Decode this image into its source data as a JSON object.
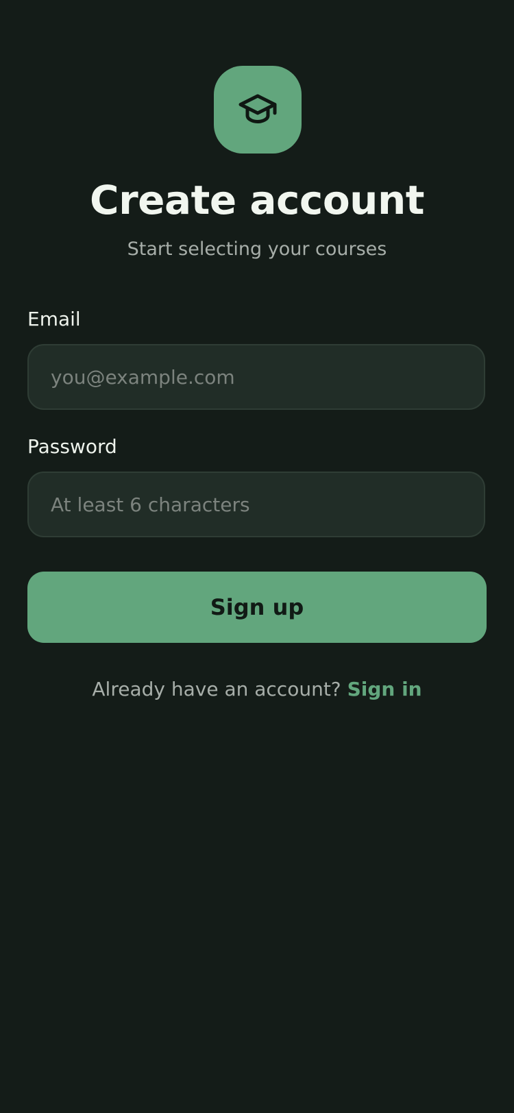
{
  "header": {
    "logo_icon": "graduation-cap-icon",
    "title": "Create account",
    "subtitle": "Start selecting your courses"
  },
  "form": {
    "email": {
      "label": "Email",
      "placeholder": "you@example.com",
      "value": ""
    },
    "password": {
      "label": "Password",
      "placeholder": "At least 6 characters",
      "value": ""
    },
    "submit_label": "Sign up"
  },
  "footer": {
    "prompt": "Already have an account?",
    "link_label": "Sign in"
  },
  "colors": {
    "background": "#141c18",
    "accent": "#62a67d",
    "input_background": "#212d27",
    "input_border": "#2f3d35",
    "muted_text": "#a7aea9"
  }
}
